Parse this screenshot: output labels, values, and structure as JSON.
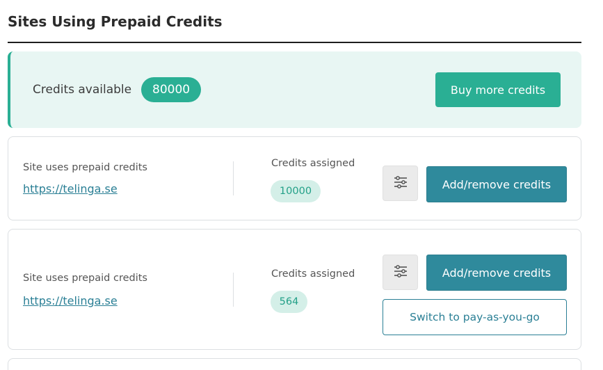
{
  "page": {
    "title": "Sites Using Prepaid Credits"
  },
  "credits": {
    "label": "Credits available",
    "amount": "80000",
    "buy_label": "Buy more credits"
  },
  "sites": [
    {
      "caption": "Site uses prepaid credits",
      "url": "https://telinga.se",
      "assigned_label": "Credits assigned",
      "assigned_value": "10000",
      "action_label": "Add/remove credits",
      "settings_icon": "sliders-icon"
    },
    {
      "caption": "Site uses prepaid credits",
      "url": "https://telinga.se",
      "assigned_label": "Credits assigned",
      "assigned_value": "564",
      "action_label": "Add/remove credits",
      "settings_icon": "sliders-icon",
      "switch_label": "Switch to pay-as-you-go"
    }
  ],
  "colors": {
    "accent_green": "#2aaf94",
    "banner_bg": "#e8f6f3",
    "action_teal": "#2f8a9c",
    "pill_bg": "#d4efe8",
    "link": "#2a7f95"
  }
}
